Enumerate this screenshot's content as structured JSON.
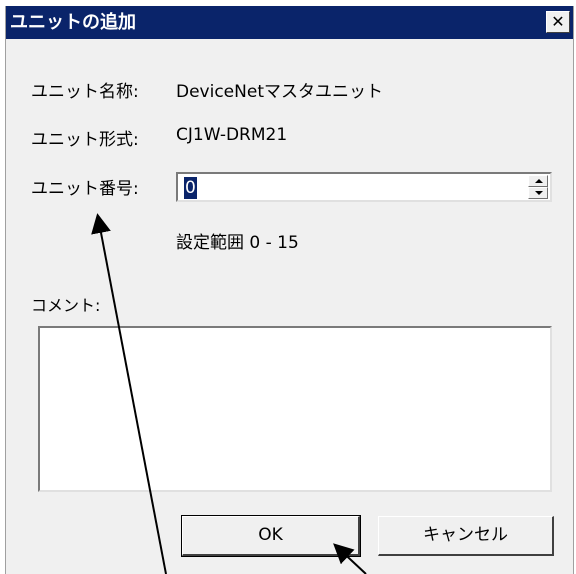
{
  "window": {
    "title": "ユニットの追加",
    "close_symbol": "✕"
  },
  "fields": {
    "unit_name_label": "ユニット名称:",
    "unit_name_value": "DeviceNetマスタユニット",
    "unit_type_label": "ユニット形式:",
    "unit_type_value": "CJ1W-DRM21",
    "unit_number_label": "ユニット番号:",
    "unit_number_value": "0",
    "range_text": "設定範囲 0 - 15",
    "comment_label": "コメント:",
    "comment_value": ""
  },
  "buttons": {
    "ok": "OK",
    "cancel": "キャンセル"
  }
}
